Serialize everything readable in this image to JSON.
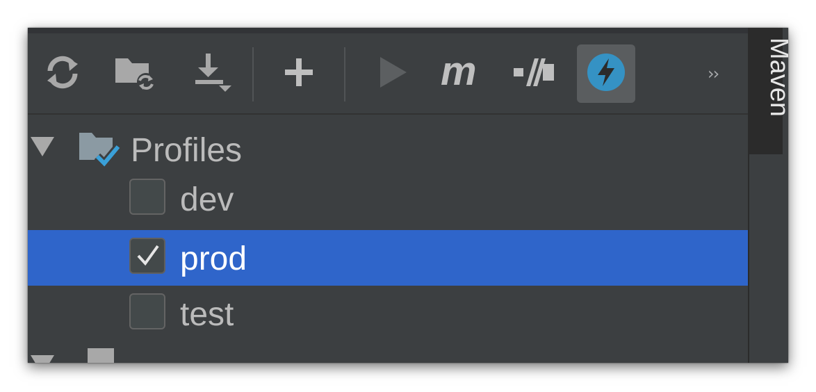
{
  "toolbar": {
    "buttons": [
      {
        "name": "reload-all-maven-projects",
        "icon": "refresh-icon"
      },
      {
        "name": "generate-sources",
        "icon": "folder-refresh-icon"
      },
      {
        "name": "download-sources",
        "icon": "download-icon"
      },
      {
        "name": "add-maven-projects",
        "icon": "plus-icon"
      },
      {
        "name": "run-maven-build",
        "icon": "play-icon"
      },
      {
        "name": "execute-maven-goal",
        "icon": "maven-m-icon"
      },
      {
        "name": "toggle-offline-mode",
        "icon": "offline-icon"
      },
      {
        "name": "toggle-skip-tests",
        "icon": "lightning-icon",
        "active": true
      }
    ],
    "more_label": "››"
  },
  "tree": {
    "profiles_label": "Profiles",
    "profiles": [
      {
        "label": "dev",
        "checked": false,
        "selected": false
      },
      {
        "label": "prod",
        "checked": true,
        "selected": true
      },
      {
        "label": "test",
        "checked": false,
        "selected": false
      }
    ]
  },
  "side_panel": {
    "label": "Maven"
  },
  "colors": {
    "panel_bg": "#3c3f41",
    "selection": "#2f65ca",
    "accent_blue": "#3592c4",
    "text": "#bbbbbb"
  }
}
